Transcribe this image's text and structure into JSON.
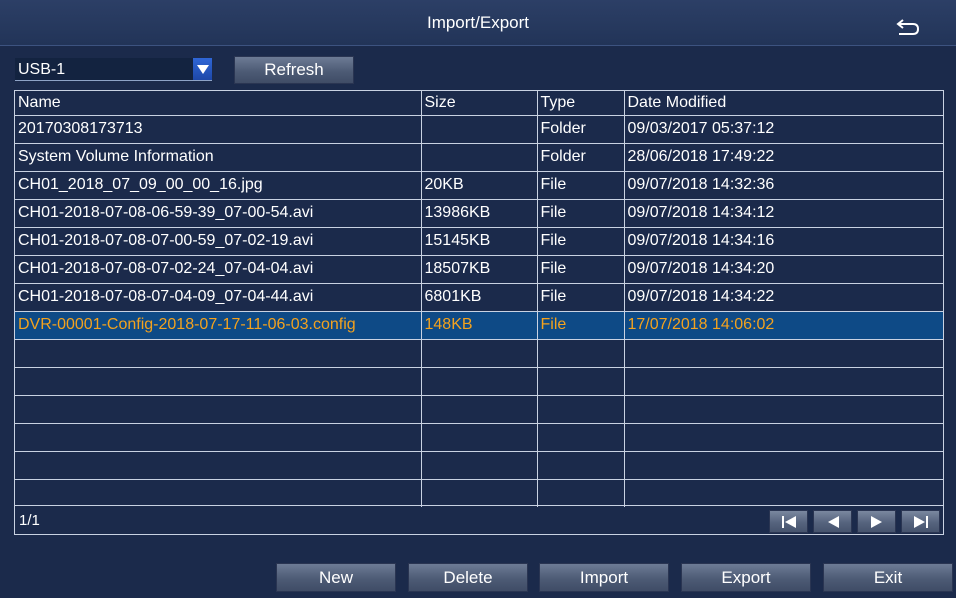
{
  "window": {
    "title": "Import/Export"
  },
  "device": {
    "selected": "USB-1"
  },
  "toolbar": {
    "refresh_label": "Refresh"
  },
  "table": {
    "columns": [
      "Name",
      "Size",
      "Type",
      "Date Modified"
    ],
    "rows": [
      {
        "name": "20170308173713",
        "size": "",
        "type": "Folder",
        "date": "09/03/2017 05:37:12"
      },
      {
        "name": "System Volume Information",
        "size": "",
        "type": "Folder",
        "date": "28/06/2018 17:49:22"
      },
      {
        "name": "CH01_2018_07_09_00_00_16.jpg",
        "size": "20KB",
        "type": "File",
        "date": "09/07/2018 14:32:36"
      },
      {
        "name": "CH01-2018-07-08-06-59-39_07-00-54.avi",
        "size": "13986KB",
        "type": "File",
        "date": "09/07/2018 14:34:12"
      },
      {
        "name": "CH01-2018-07-08-07-00-59_07-02-19.avi",
        "size": "15145KB",
        "type": "File",
        "date": "09/07/2018 14:34:16"
      },
      {
        "name": "CH01-2018-07-08-07-02-24_07-04-04.avi",
        "size": "18507KB",
        "type": "File",
        "date": "09/07/2018 14:34:20"
      },
      {
        "name": "CH01-2018-07-08-07-04-09_07-04-44.avi",
        "size": "6801KB",
        "type": "File",
        "date": "09/07/2018 14:34:22"
      },
      {
        "name": "DVR-00001-Config-2018-07-17-11-06-03.config",
        "size": "148KB",
        "type": "File",
        "date": "17/07/2018 14:06:02"
      }
    ],
    "selected_row": 7,
    "empty_rows": 6
  },
  "pager": {
    "page_label": "1/1"
  },
  "actions": {
    "new_label": "New",
    "delete_label": "Delete",
    "import_label": "Import",
    "export_label": "Export",
    "exit_label": "Exit"
  },
  "icons": {
    "back": "back-arrow-icon",
    "dropdown": "chevron-down-icon",
    "first": "first-page-icon",
    "prev": "prev-page-icon",
    "next": "next-page-icon",
    "last": "last-page-icon"
  },
  "colors": {
    "background": "#1b2a4b",
    "selected_row": "#0e4a86",
    "selected_text": "#f3a21e",
    "grid": "#c9d2e2"
  }
}
